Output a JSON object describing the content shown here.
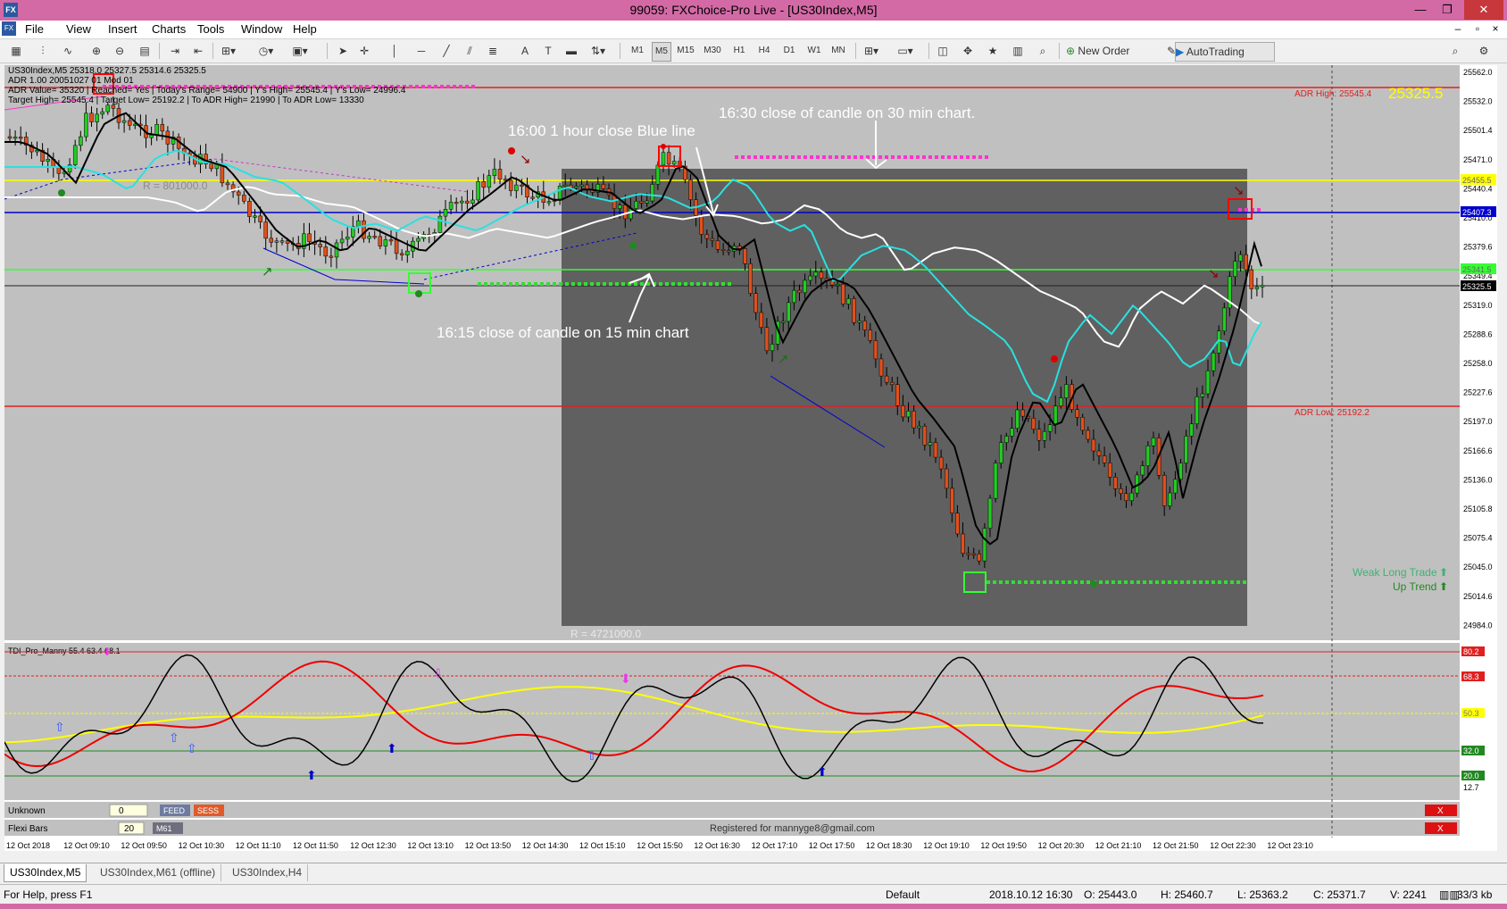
{
  "window": {
    "title": "99059: FXChoice-Pro Live - [US30Index,M5]",
    "app_icon": "FX",
    "controls": [
      "—",
      "❐",
      "✕"
    ]
  },
  "menu": {
    "items": [
      "File",
      "View",
      "Insert",
      "Charts",
      "Tools",
      "Window",
      "Help"
    ],
    "mdi_controls": [
      "–",
      "▫",
      "×"
    ]
  },
  "toolbar": {
    "timeframes": [
      "M1",
      "M5",
      "M15",
      "M30",
      "H1",
      "H4",
      "D1",
      "W1",
      "MN"
    ],
    "active_timeframe": "M5",
    "new_order_label": "New Order",
    "autotrading_label": "AutoTrading"
  },
  "chart": {
    "info_line1": "US30Index,M5  25318.0 25327.5 25314.6 25325.5",
    "info_line2": "ADR 1.00 20051027 01 Mod 01",
    "info_line3": "ADR Value= 35320 | Reached= Yes | Today's Range= 54900 | Y's High= 25545.4 | Y's Low= 24996.4",
    "info_line4": "Target High= 25545.4 | Target Low= 25192.2 | To ADR High= 21990 | To ADR Low= 13330",
    "adr_high_label": "ADR High: 25545.4",
    "adr_low_label": "ADR Low: 25192.2",
    "big_price": "25325.5",
    "r_label_left": "R = 801000.0",
    "r_label_box": "R = 4721000.0",
    "annotations": {
      "a1": "16:00 1 hour close Blue line",
      "a2": "16:30 close of candle on 30 min chart.",
      "a3": "16:15 close of candle on 15 min chart"
    },
    "trade_status_1": "Weak Long Trade",
    "trade_status_2": "Up Trend",
    "price_axis": [
      "25562.0",
      "25532.0",
      "25501.4",
      "25471.0",
      "25440.4",
      "25410.0",
      "25379.6",
      "25349.4",
      "25319.0",
      "25288.6",
      "25258.0",
      "25227.6",
      "25197.0",
      "25166.6",
      "25136.0",
      "25105.8",
      "25075.4",
      "25045.0",
      "25014.6",
      "24984.0"
    ],
    "price_tags": {
      "yellow": "25455.5",
      "blue": "25407.3",
      "green": "25341.5",
      "current": "25325.5"
    },
    "colors": {
      "adr_line": "#e02020",
      "yellow_line": "#ffff00",
      "blue_line": "#0000cc",
      "green_line": "#33ff33",
      "ema_cyan": "#2ae0e0",
      "bull_candle": "#22cc22",
      "bear_candle": "#e0501c",
      "magenta_dots": "#ff33cc"
    }
  },
  "indicator": {
    "label": "TDI_Pro_Manny 55.4 63.4 68.1",
    "levels": [
      "80.2",
      "68.3",
      "50.3",
      "32.0",
      "20.0",
      "12.7"
    ]
  },
  "rows": {
    "unknown_label": "Unknown",
    "unknown_value": "0",
    "feed": "FEED",
    "sess": "SESS",
    "flexi_label": "Flexi Bars",
    "flexi_value": "20",
    "flexi_tf": "M61",
    "registered": "Registered for mannyge8@gmail.com",
    "close_x": "X"
  },
  "time_axis": [
    "12 Oct 2018",
    "12 Oct 09:10",
    "12 Oct 09:50",
    "12 Oct 10:30",
    "12 Oct 11:10",
    "12 Oct 11:50",
    "12 Oct 12:30",
    "12 Oct 13:10",
    "12 Oct 13:50",
    "12 Oct 14:30",
    "12 Oct 15:10",
    "12 Oct 15:50",
    "12 Oct 16:30",
    "12 Oct 17:10",
    "12 Oct 17:50",
    "12 Oct 18:30",
    "12 Oct 19:10",
    "12 Oct 19:50",
    "12 Oct 20:30",
    "12 Oct 21:10",
    "12 Oct 21:50",
    "12 Oct 22:30",
    "12 Oct 23:10"
  ],
  "tabs": [
    "US30Index,M5",
    "US30Index,M61 (offline)",
    "US30Index,H4"
  ],
  "status": {
    "help": "For Help, press F1",
    "profile": "Default",
    "datetime": "2018.10.12 16:30",
    "open": "O: 25443.0",
    "high": "H: 25460.7",
    "low": "L: 25363.2",
    "close": "C: 25371.7",
    "volume": "V: 2241",
    "traffic": "33/3 kb"
  }
}
